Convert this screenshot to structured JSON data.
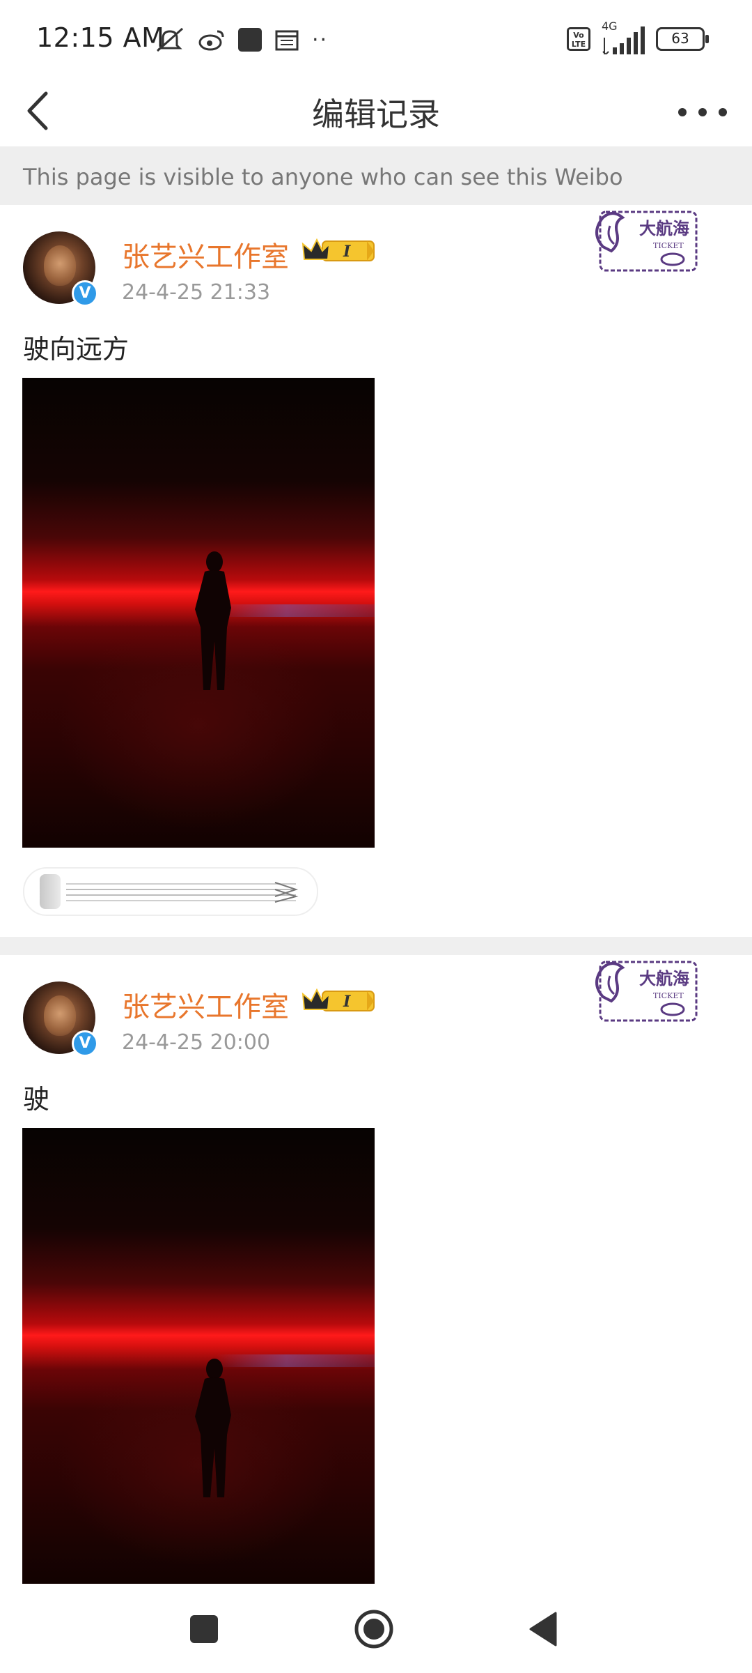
{
  "status_bar": {
    "time": "12:15 AM",
    "network": "4G",
    "battery": "63",
    "volte": "Vo LTE"
  },
  "header": {
    "title": "编辑记录",
    "back_icon": "chevron-left-icon",
    "more_icon": "more-horizontal-icon"
  },
  "notice": {
    "text": "This page is visible to anyone who can see this Weibo"
  },
  "posts": [
    {
      "username": "张艺兴工作室",
      "badge": "I",
      "timestamp": "24-4-25 21:33",
      "text": "驶向远方",
      "stamp_text": "大航海",
      "stamp_sub": "TICKET"
    },
    {
      "username": "张艺兴工作室",
      "badge": "I",
      "timestamp": "24-4-25 20:00",
      "text": "驶",
      "stamp_text": "大航海",
      "stamp_sub": "TICKET"
    }
  ],
  "colors": {
    "username": "#e8762c",
    "verified": "#2f9ae8",
    "notice_bg": "#eeeeee"
  }
}
